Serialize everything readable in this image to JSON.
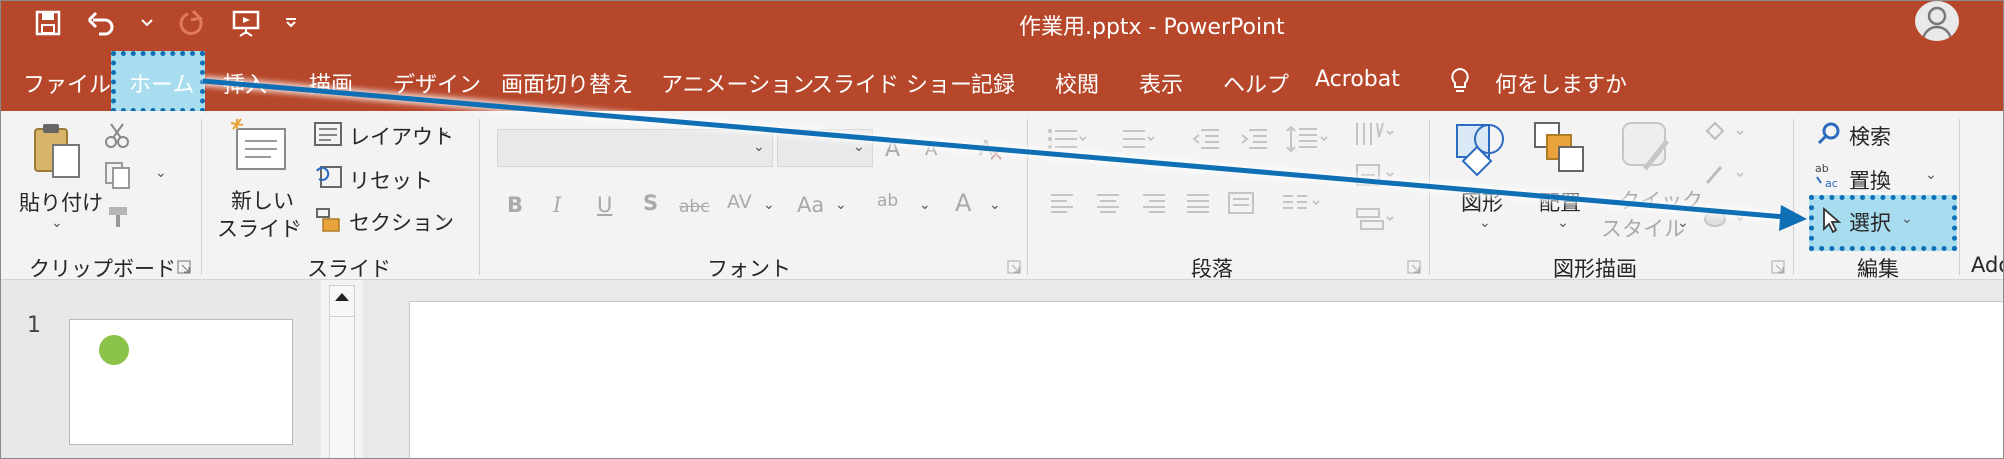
{
  "window": {
    "title": "作業用.pptx  -  PowerPoint",
    "qat": [
      {
        "name": "save-icon",
        "glyph": "💾"
      },
      {
        "name": "undo-icon",
        "glyph": "↶"
      },
      {
        "name": "undo-dropdown-icon",
        "glyph": "⌄"
      },
      {
        "name": "redo-icon",
        "glyph": "↻"
      },
      {
        "name": "present-icon",
        "glyph": "📽"
      },
      {
        "name": "customize-qat-icon",
        "glyph": "⌄"
      }
    ]
  },
  "tabs": {
    "file": "ファイル",
    "home": "ホーム",
    "insert": "挿入",
    "draw": "描画",
    "design": "デザイン",
    "transitions": "画面切り替え",
    "animations": "アニメーション",
    "slideshow": "スライド ショー",
    "record": "記録",
    "review": "校閲",
    "view": "表示",
    "help": "ヘルプ",
    "acrobat": "Acrobat",
    "tellme": "何をしますか"
  },
  "ribbon": {
    "clipboard": {
      "paste": "貼り付け",
      "label": "クリップボード"
    },
    "slides": {
      "new_slide_1": "新しい",
      "new_slide_2": "スライド",
      "layout": "レイアウト",
      "reset": "リセット",
      "section": "セクション",
      "label": "スライド"
    },
    "font": {
      "label": "フォント",
      "bold": "B",
      "italic": "I",
      "underline": "U",
      "shadow": "S",
      "strike": "abc",
      "spacing": "AV",
      "case": "Aa",
      "highlight": "ab",
      "color": "A",
      "grow": "A",
      "shrink": "A"
    },
    "paragraph": {
      "label": "段落"
    },
    "drawing": {
      "shapes": "図形",
      "arrange": "配置",
      "quick_styles_1": "クイック",
      "quick_styles_2": "スタイル",
      "label": "図形描画"
    },
    "editing": {
      "find": "検索",
      "replace": "置換",
      "select": "選択",
      "label": "編集"
    },
    "next_group_partial": "Ado"
  },
  "thumbnails": {
    "slide_number": "1"
  },
  "colors": {
    "titlebar": "#b7472a",
    "highlight_fill": "#a8dcef",
    "highlight_border": "#0f6fb5",
    "thumb_dot": "#8bc34a"
  }
}
